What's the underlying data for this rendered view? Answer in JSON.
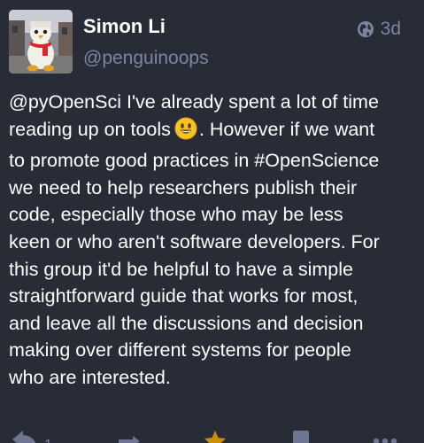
{
  "author": {
    "display_name": "Simon Li",
    "username": "@penguinoops"
  },
  "meta": {
    "visibility_icon": "globe-icon",
    "timestamp": "3d"
  },
  "content": {
    "lines": [
      "@pyOpenSci I've already spent a lot of time",
      "reading up on tools",
      ". However if we want",
      "to promote good practices in #OpenScience",
      "we need to help researchers publish their",
      "code, especially those who may be less",
      "keen or who aren't software developers. For",
      "this group it'd be helpful to have a simple",
      "straightforward guide that works for most,",
      "and leave all the discussions and decision",
      "making over different systems for people",
      "who are interested."
    ],
    "emoji_icon": "smiley-emoji-icon"
  },
  "actions": {
    "reply_count": "1",
    "icons": [
      "reply-icon",
      "boost-icon",
      "star-icon",
      "bookmark-icon",
      "more-icon"
    ]
  },
  "colors": {
    "background": "#282c37",
    "text": "#ffffff",
    "secondary": "#7d859e",
    "icon": "#6d7590",
    "star": "#ca8f04",
    "emoji": "#f7c324"
  }
}
